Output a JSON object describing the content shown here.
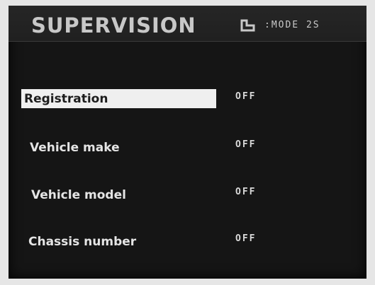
{
  "header": {
    "title": "SUPERVISION",
    "mode_text": ":MODE 2S",
    "mode_icon": "mode-symbol-icon"
  },
  "menu": {
    "items": [
      {
        "label": "Registration",
        "value": "OFF",
        "selected": true
      },
      {
        "label": "Vehicle make",
        "value": "OFF",
        "selected": false
      },
      {
        "label": "Vehicle model",
        "value": "OFF",
        "selected": false
      },
      {
        "label": "Chassis number",
        "value": "OFF",
        "selected": false
      }
    ]
  },
  "colors": {
    "background": "#151515",
    "text": "#e5e5e5",
    "highlight": "#efefef",
    "highlight_text": "#1d1d1d"
  }
}
